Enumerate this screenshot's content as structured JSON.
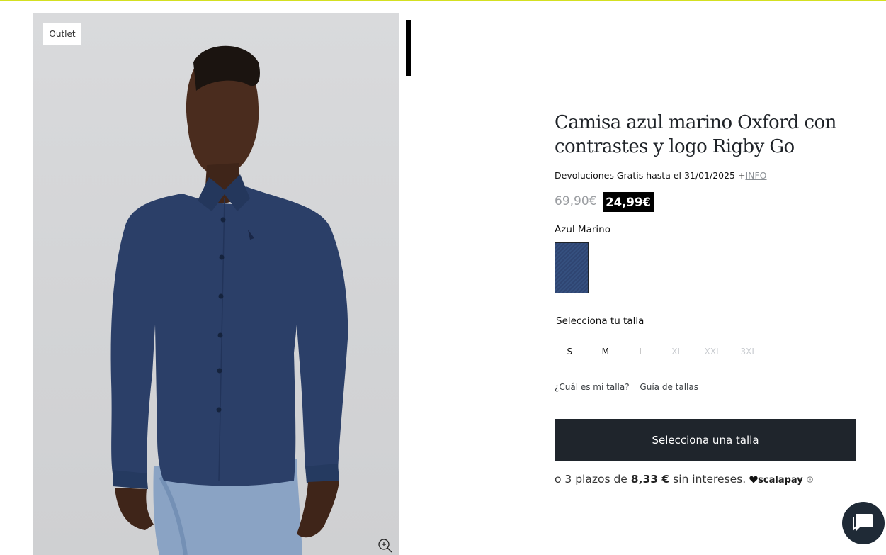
{
  "product": {
    "badge": "Outlet",
    "title": "Camisa azul marino Oxford con contrastes y logo Rigby Go",
    "returns_text": "Devoluciones Gratis hasta el 31/01/2025 +",
    "returns_link": "INFO",
    "old_price": "69,90€",
    "new_price": "24,99€",
    "color_name": "Azul Marino",
    "size_title": "Selecciona tu talla",
    "sizes": [
      {
        "label": "S",
        "available": true
      },
      {
        "label": "M",
        "available": true
      },
      {
        "label": "L",
        "available": true
      },
      {
        "label": "XL",
        "available": false
      },
      {
        "label": "XXL",
        "available": false
      },
      {
        "label": "3XL",
        "available": false
      }
    ],
    "size_help_link": "¿Cuál es mi talla?",
    "size_guide_link": "Guía de tallas",
    "cta_label": "Selecciona una talla",
    "installments": {
      "prefix": "o 3 plazos de ",
      "amount": "8,33 €",
      "suffix": " sin intereses.",
      "provider": "scalapay"
    }
  },
  "colors": {
    "accent_line": "#d4e021",
    "cta_bg": "#1f252c",
    "shirt": "#2b3f68",
    "swatch": "#2f4572",
    "chat_bg": "#1f2a36"
  },
  "icons": [
    "zoom-in-icon",
    "heart-icon",
    "info-icon",
    "chat-icon",
    "scroll-up-icon"
  ]
}
